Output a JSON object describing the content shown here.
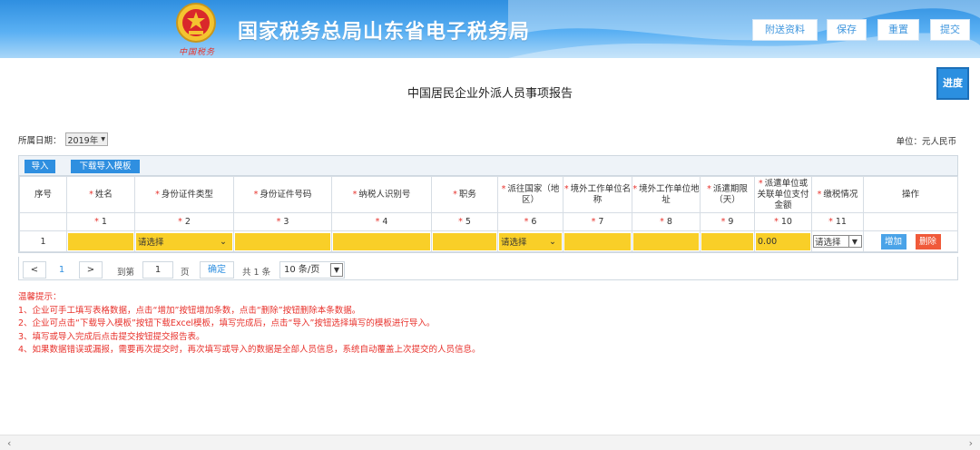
{
  "header": {
    "title": "国家税务总局山东省电子税务局",
    "emblem_text": "中国税务",
    "buttons": {
      "attach": "附送资料",
      "save": "保存",
      "reset": "重置",
      "submit": "提交"
    }
  },
  "progress_label": "进度",
  "report_title": "中国居民企业外派人员事项报告",
  "date_field": {
    "label": "所属日期：",
    "value": "2019年"
  },
  "unit_label": "单位：元人民币",
  "toolbar": {
    "import": "导入",
    "download_template": "下载导入模板"
  },
  "table": {
    "columns": [
      {
        "label": "序号",
        "req": "",
        "code": ""
      },
      {
        "label": "姓名",
        "req": "*",
        "code": "* 1"
      },
      {
        "label": "身份证件类型",
        "req": "*",
        "code": "* 2"
      },
      {
        "label": "身份证件号码",
        "req": "*",
        "code": "* 3"
      },
      {
        "label": "纳税人识别号",
        "req": "*",
        "code": "* 4"
      },
      {
        "label": "职务",
        "req": "*",
        "code": "* 5"
      },
      {
        "label": "派往国家（地区）",
        "req": "*",
        "code": "* 6"
      },
      {
        "label": "境外工作单位名称",
        "req": "*",
        "code": "* 7"
      },
      {
        "label": "境外工作单位地址",
        "req": "*",
        "code": "* 8"
      },
      {
        "label": "派遣期限（天）",
        "req": "*",
        "code": "* 9"
      },
      {
        "label": "派遣单位或关联单位支付金额",
        "req": "*",
        "code": "* 10"
      },
      {
        "label": "缴税情况",
        "req": "*",
        "code": "* 11"
      },
      {
        "label": "操作",
        "req": "",
        "code": ""
      }
    ],
    "row": {
      "index": "1",
      "id_type": "请选择",
      "country": "请选择",
      "amount": "0.00",
      "tax_status": "请选择",
      "add": "增加",
      "delete": "删除"
    }
  },
  "pager": {
    "prev": "<",
    "current": "1",
    "next": ">",
    "goto_label": "到第",
    "page_input": "1",
    "page_unit": "页",
    "confirm": "确定",
    "total": "共 1 条",
    "per_page": "10 条/页"
  },
  "tips": {
    "title": "温馨提示：",
    "items": [
      "1、企业可手工填写表格数据，点击“增加”按钮增加条数，点击“删除”按钮删除本条数据。",
      "2、企业可点击“下载导入模板”按钮下载Excel模板，填写完成后，点击“导入”按钮选择填写的模板进行导入。",
      "3、填写或导入完成后点击提交按钮提交报告表。",
      "4、如果数据错误或漏报，需要再次提交时，再次填写或导入的数据是全部人员信息，系统自动覆盖上次提交的人员信息。"
    ]
  },
  "colors": {
    "primary": "#2f8fe0",
    "warn": "#e8322c",
    "field": "#f9cf28",
    "delete": "#f05a3a"
  }
}
